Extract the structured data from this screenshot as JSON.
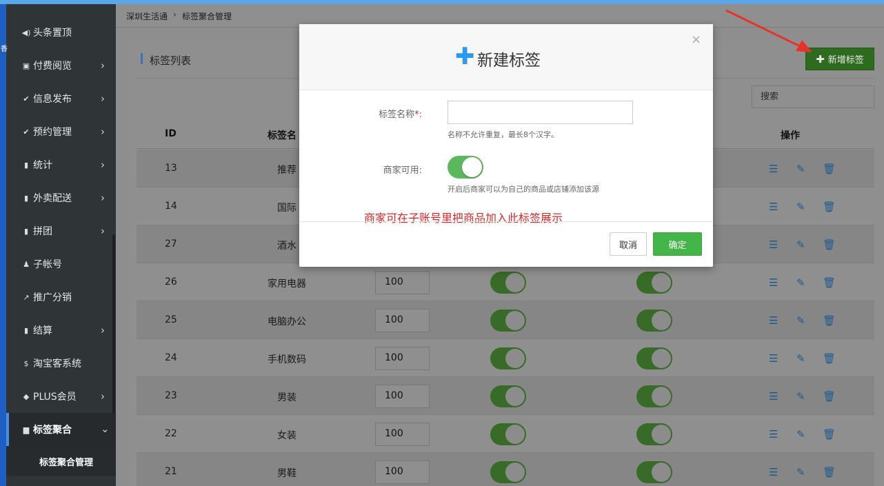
{
  "breadcrumb": [
    "深圳生活通",
    "标签聚合管理"
  ],
  "sidebar": {
    "edge_glyph": "香",
    "items": [
      {
        "label": "头条置顶",
        "icon": "◀)",
        "chevron": false
      },
      {
        "label": "付费阅览",
        "icon": "▣",
        "chevron": true
      },
      {
        "label": "信息发布",
        "icon": "✔",
        "chevron": true
      },
      {
        "label": "预约管理",
        "icon": "✔",
        "chevron": true
      },
      {
        "label": "统计",
        "icon": "▮",
        "chevron": true
      },
      {
        "label": "外卖配送",
        "icon": "▮",
        "chevron": true
      },
      {
        "label": "拼团",
        "icon": "▮",
        "chevron": true
      },
      {
        "label": "子帐号",
        "icon": "♟",
        "chevron": false
      },
      {
        "label": "推广分销",
        "icon": "↗",
        "chevron": false
      },
      {
        "label": "结算",
        "icon": "▮",
        "chevron": true
      },
      {
        "label": "淘宝客系统",
        "icon": "$",
        "chevron": false
      },
      {
        "label": "PLUS会员",
        "icon": "◆",
        "chevron": true
      },
      {
        "label": "标签聚合",
        "icon": "▆",
        "chevron": true,
        "active": true
      }
    ],
    "submenu_label": "标签聚合管理",
    "chevron_right": "›",
    "chevron_down": "⌄"
  },
  "panel": {
    "title": "标签列表",
    "add_button": "新增标签",
    "add_plus": "✚",
    "search_placeholder": "搜索"
  },
  "table": {
    "headers": {
      "id": "ID",
      "name": "标签名",
      "action": "操作"
    },
    "rows": [
      {
        "id": "13",
        "name": "推荐",
        "sort": "",
        "merchant": true,
        "show": true
      },
      {
        "id": "14",
        "name": "国际",
        "sort": "",
        "merchant": true,
        "show": true
      },
      {
        "id": "27",
        "name": "酒水",
        "sort": "",
        "merchant": true,
        "show": true
      },
      {
        "id": "26",
        "name": "家用电器",
        "sort": "100",
        "merchant": true,
        "show": true
      },
      {
        "id": "25",
        "name": "电脑办公",
        "sort": "100",
        "merchant": true,
        "show": true
      },
      {
        "id": "24",
        "name": "手机数码",
        "sort": "100",
        "merchant": true,
        "show": true
      },
      {
        "id": "23",
        "name": "男装",
        "sort": "100",
        "merchant": true,
        "show": true
      },
      {
        "id": "22",
        "name": "女装",
        "sort": "100",
        "merchant": true,
        "show": true
      },
      {
        "id": "21",
        "name": "男鞋",
        "sort": "100",
        "merchant": true,
        "show": true
      }
    ],
    "action_icons": {
      "list": "☰",
      "edit": "✎",
      "delete": "🗑"
    }
  },
  "dialog": {
    "close": "×",
    "plus": "✚",
    "title": "新建标签",
    "name_label": "标签名称",
    "required_mark": "*",
    "name_suffix": ":",
    "name_value": "",
    "name_hint": "名称不允许重复，最长8个汉字。",
    "merchant_label": "商家可用:",
    "merchant_enabled": true,
    "merchant_hint": "开启后商家可以为自己的商品或店铺添加该源",
    "annotation": "商家可在子账号里把商品加入此标签展示",
    "cancel": "取消",
    "confirm": "确定"
  },
  "colors": {
    "accent": "#5aa7e8",
    "switch_on": "#5cb85c",
    "confirm": "#44b549",
    "annotation": "#e02424",
    "dialog_plus": "#2b9af3"
  }
}
